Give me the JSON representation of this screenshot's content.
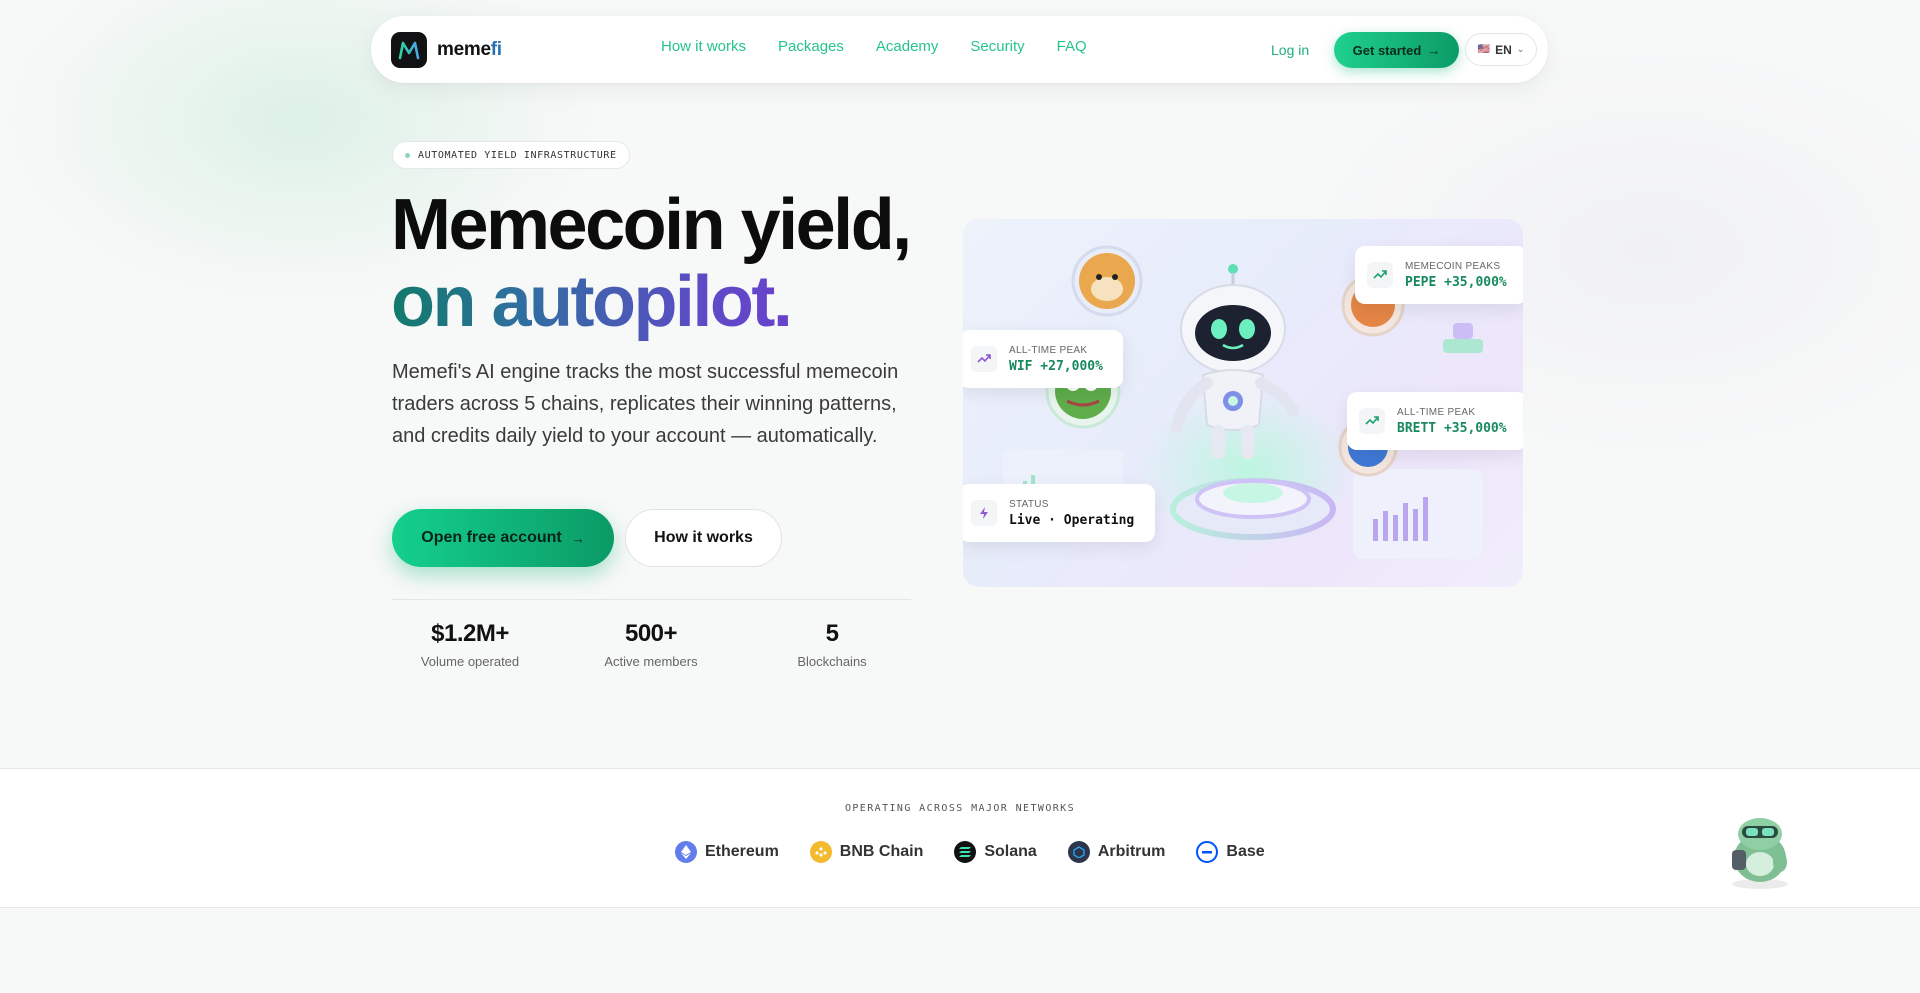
{
  "nav": {
    "logo_part1": "meme",
    "logo_part2": "fi",
    "links": [
      "How it works",
      "Packages",
      "Academy",
      "Security",
      "FAQ"
    ],
    "login": "Log in",
    "cta": "Get started",
    "cta_arrow": "→",
    "lang": "EN",
    "lang_flag": "🇺🇸",
    "lang_chevron": "⌄"
  },
  "hero": {
    "badge": "AUTOMATED YIELD INFRASTRUCTURE",
    "title_line1": "Memecoin yield,",
    "title_line2": "on autopilot.",
    "lead": "Memefi's AI engine tracks the most successful memecoin traders across 5 chains, replicates their winning patterns, and credits daily yield to your account — automatically.",
    "primary_button": "Open free account",
    "primary_arrow": "→",
    "secondary_button": "How it works",
    "stats": [
      {
        "value": "$1.2M+",
        "label": "Volume operated"
      },
      {
        "value": "500+",
        "label": "Active members"
      },
      {
        "value": "5",
        "label": "Blockchains"
      }
    ]
  },
  "illustration": {
    "cards": [
      {
        "label": "MEMECOIN PEAKS",
        "value": "PEPE +35,000%",
        "icon": "trend-up-icon"
      },
      {
        "label": "ALL-TIME PEAK",
        "value": "WIF +27,000%",
        "icon": "trend-up-icon"
      },
      {
        "label": "ALL-TIME PEAK",
        "value": "BRETT +35,000%",
        "icon": "trend-up-icon"
      },
      {
        "label": "STATUS",
        "value": "Live · Operating",
        "icon": "bolt-icon"
      }
    ]
  },
  "networks": {
    "title": "OPERATING ACROSS MAJOR NETWORKS",
    "items": [
      {
        "name": "Ethereum",
        "color": "#627eea"
      },
      {
        "name": "BNB Chain",
        "color": "#f3ba2f"
      },
      {
        "name": "Solana",
        "color": "#111111"
      },
      {
        "name": "Arbitrum",
        "color": "#2d374b"
      },
      {
        "name": "Base",
        "color": "#0052ff"
      }
    ]
  },
  "colors": {
    "accent": "#1fd08e",
    "link": "#27c48a",
    "gradient_start": "#127a6a",
    "gradient_end": "#7a35d3"
  }
}
